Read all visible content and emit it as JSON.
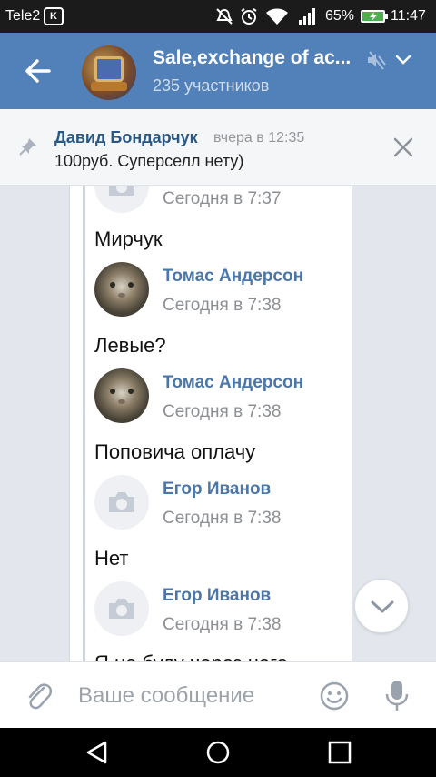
{
  "status_bar": {
    "carrier": "Tele2",
    "badge": "K",
    "battery_percent": "65%",
    "time": "11:47"
  },
  "header": {
    "title": "Sale,exchange of ac...",
    "subtitle": "235 участников"
  },
  "pinned": {
    "author": "Давид Бондарчук",
    "time": "вчера в 12:35",
    "text": "100руб. Суперселл нету)"
  },
  "messages": [
    {
      "author": "",
      "time": "Сегодня в 7:37",
      "avatar": "camera-placeholder",
      "text": "Мирчук"
    },
    {
      "author": "Томас Андерсон",
      "time": "Сегодня в 7:38",
      "avatar": "cat-photo",
      "text": "Левые?"
    },
    {
      "author": "Томас Андерсон",
      "time": "Сегодня в 7:38",
      "avatar": "cat-photo",
      "text": "Поповича оплачу"
    },
    {
      "author": "Егор Иванов",
      "time": "Сегодня в 7:38",
      "avatar": "camera-placeholder",
      "text": "Нет"
    },
    {
      "author": "Егор Иванов",
      "time": "Сегодня в 7:38",
      "avatar": "camera-placeholder",
      "text": "Я не буду через него"
    }
  ],
  "composer": {
    "placeholder": "Ваше сообщение"
  },
  "colors": {
    "header_bg": "#5181b8",
    "link_blue": "#4b76a8",
    "pinned_author": "#2a5885"
  }
}
